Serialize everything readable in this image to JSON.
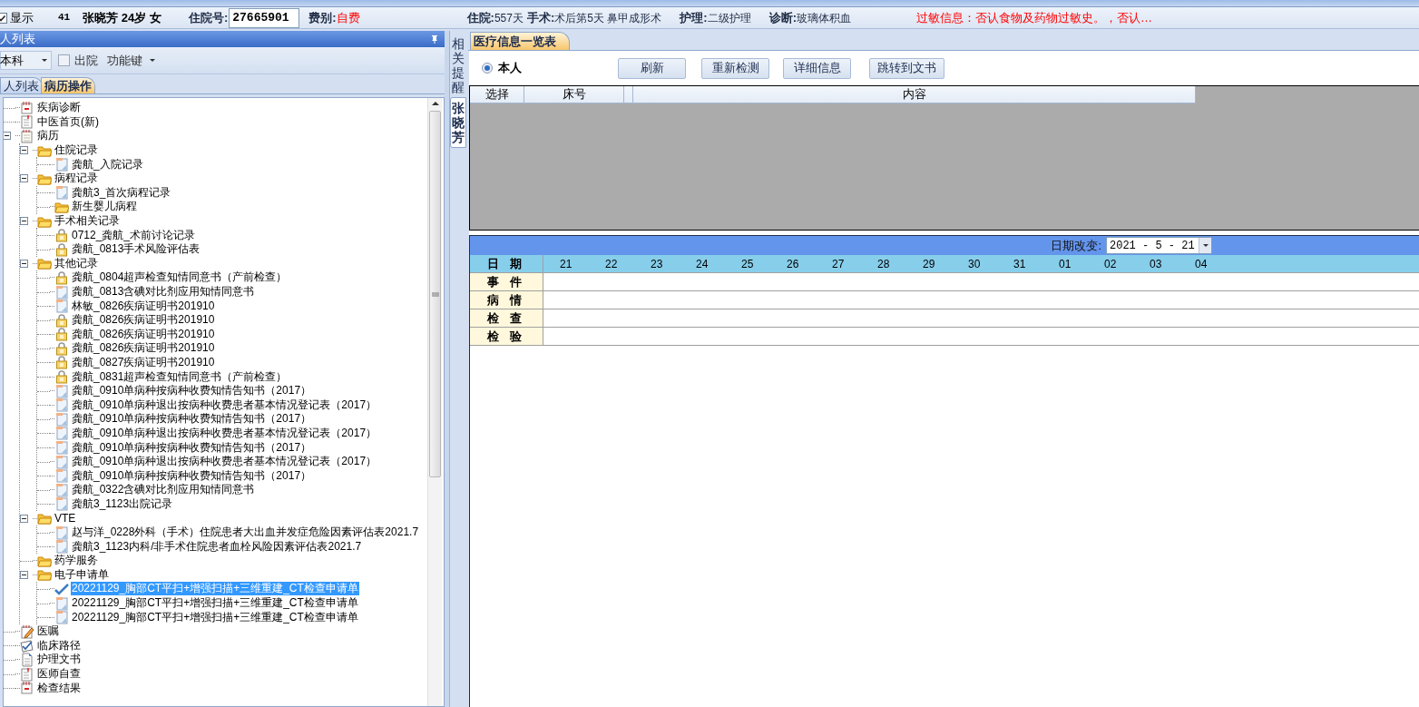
{
  "header": {
    "show": {
      "label": "显示",
      "checked": true
    },
    "bed": "41",
    "patient": "张晓芳 24岁 女",
    "left_fields": [
      {
        "label": "住院号:",
        "value": "27665901",
        "kind": "input"
      },
      {
        "label": "费别:",
        "value": "自费",
        "kind": "alert"
      }
    ],
    "right_fields": [
      {
        "label": "住院:",
        "value": "557天",
        "kind": "text"
      },
      {
        "label": "手术:",
        "value": "术后第5天 鼻甲成形术",
        "kind": "text"
      },
      {
        "label": "护理:",
        "value": "二级护理",
        "kind": "text"
      },
      {
        "label": "诊断:",
        "value": "玻璃体积血",
        "kind": "text"
      }
    ],
    "allergy": "过敏信息：否认食物及药物过敏史。，否认…"
  },
  "left_panel": {
    "title": "人列表",
    "dept": "本科",
    "discharged": {
      "label": "出院",
      "checked": false
    },
    "function_key": "功能键",
    "tabs": [
      {
        "label": "人列表",
        "selected": false
      },
      {
        "label": "病历操作",
        "selected": true
      }
    ],
    "tree": [
      {
        "label": "疾病诊断",
        "kind": "calendar",
        "selected": false
      },
      {
        "label": "中医首页(新)",
        "kind": "clipboard",
        "selected": false
      },
      {
        "label": "病历",
        "kind": "notebook",
        "selected": false,
        "expanded": true,
        "children": [
          {
            "label": "住院记录",
            "kind": "folder",
            "selected": false,
            "expanded": true,
            "children": [
              {
                "label": "龚航_入院记录",
                "kind": "document",
                "selected": false
              }
            ]
          },
          {
            "label": "病程记录",
            "kind": "folder",
            "selected": false,
            "expanded": true,
            "children": [
              {
                "label": "龚航3_首次病程记录",
                "kind": "document",
                "selected": false
              },
              {
                "label": "新生婴儿病程",
                "kind": "folder",
                "selected": false
              }
            ]
          },
          {
            "label": "手术相关记录",
            "kind": "folder",
            "selected": false,
            "expanded": true,
            "children": [
              {
                "label": "0712_龚航_术前讨论记录",
                "kind": "lock",
                "selected": false
              },
              {
                "label": "龚航_0813手术风险评估表",
                "kind": "lock",
                "selected": false
              }
            ]
          },
          {
            "label": "其他记录",
            "kind": "folder",
            "selected": false,
            "expanded": true,
            "children": [
              {
                "label": "龚航_0804超声检查知情同意书（产前检查）",
                "kind": "lock",
                "selected": false
              },
              {
                "label": "龚航_0813含碘对比剂应用知情同意书",
                "kind": "document",
                "selected": false
              },
              {
                "label": "林敏_0826疾病证明书201910",
                "kind": "document",
                "selected": false
              },
              {
                "label": "龚航_0826疾病证明书201910",
                "kind": "lock",
                "selected": false
              },
              {
                "label": "龚航_0826疾病证明书201910",
                "kind": "lock",
                "selected": false
              },
              {
                "label": "龚航_0826疾病证明书201910",
                "kind": "lock",
                "selected": false
              },
              {
                "label": "龚航_0827疾病证明书201910",
                "kind": "lock",
                "selected": false
              },
              {
                "label": "龚航_0831超声检查知情同意书（产前检查）",
                "kind": "lock",
                "selected": false
              },
              {
                "label": "龚航_0910单病种按病种收费知情告知书（2017）",
                "kind": "document",
                "selected": false
              },
              {
                "label": "龚航_0910单病种退出按病种收费患者基本情况登记表（2017）",
                "kind": "document",
                "selected": false
              },
              {
                "label": "龚航_0910单病种按病种收费知情告知书（2017）",
                "kind": "document",
                "selected": false
              },
              {
                "label": "龚航_0910单病种退出按病种收费患者基本情况登记表（2017）",
                "kind": "document",
                "selected": false
              },
              {
                "label": "龚航_0910单病种按病种收费知情告知书（2017）",
                "kind": "document",
                "selected": false
              },
              {
                "label": "龚航_0910单病种退出按病种收费患者基本情况登记表（2017）",
                "kind": "document",
                "selected": false
              },
              {
                "label": "龚航_0910单病种按病种收费知情告知书（2017）",
                "kind": "document",
                "selected": false
              },
              {
                "label": "龚航_0322含碘对比剂应用知情同意书",
                "kind": "document",
                "selected": false
              },
              {
                "label": "龚航3_1123出院记录",
                "kind": "document",
                "selected": false
              }
            ]
          },
          {
            "label": "VTE",
            "kind": "folder",
            "selected": false,
            "expanded": true,
            "children": [
              {
                "label": "赵与洋_0228外科（手术）住院患者大出血并发症危险因素评估表2021.7",
                "kind": "document",
                "selected": false
              },
              {
                "label": "龚航3_1123内科/非手术住院患者血栓风险因素评估表2021.7",
                "kind": "document",
                "selected": false
              }
            ]
          },
          {
            "label": "药学服务",
            "kind": "folder",
            "selected": false
          },
          {
            "label": "电子申请单",
            "kind": "folder",
            "selected": false,
            "expanded": true,
            "children": [
              {
                "label": "20221129_胸部CT平扫+增强扫描+三维重建_CT检查申请单",
                "kind": "check",
                "selected": true
              },
              {
                "label": "20221129_胸部CT平扫+增强扫描+三维重建_CT检查申请单",
                "kind": "document",
                "selected": false
              },
              {
                "label": "20221129_胸部CT平扫+增强扫描+三维重建_CT检查申请单",
                "kind": "document",
                "selected": false
              }
            ]
          }
        ]
      },
      {
        "label": "医嘱",
        "kind": "edit",
        "selected": false
      },
      {
        "label": "临床路径",
        "kind": "path",
        "selected": false
      },
      {
        "label": "护理文书",
        "kind": "page",
        "selected": false
      },
      {
        "label": "医师自查",
        "kind": "clipboard",
        "selected": false
      },
      {
        "label": "检查结果",
        "kind": "calendar",
        "selected": false
      }
    ]
  },
  "side_tabs": [
    {
      "label": "相关提醒",
      "selected": false
    },
    {
      "label": "张晓芳",
      "selected": true
    }
  ],
  "main": {
    "tab": "医疗信息一览表",
    "radio": {
      "label": "本人",
      "selected": true
    },
    "buttons": [
      "刷新",
      "重新检测",
      "详细信息",
      "跳转到文书"
    ],
    "columns": [
      "选择",
      "床号",
      "内容"
    ],
    "timeline": {
      "date_label": "日期改变:",
      "date_value": "2021 - 5 - 21",
      "header": "日 期",
      "days": [
        "21",
        "22",
        "23",
        "24",
        "25",
        "26",
        "27",
        "28",
        "29",
        "30",
        "31",
        "01",
        "02",
        "03",
        "04"
      ],
      "rows": [
        "事 件",
        "病 情",
        "检 查",
        "检 验"
      ]
    }
  }
}
